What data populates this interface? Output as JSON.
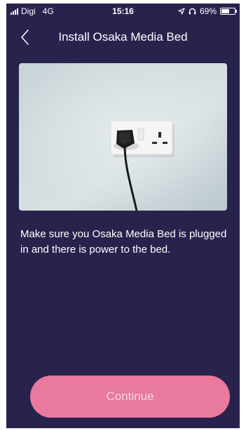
{
  "status_bar": {
    "carrier": "Digi",
    "network": "4G",
    "time": "15:16",
    "battery_percent": "69%",
    "battery_level": 0.69,
    "icons": [
      "signal-bars-icon",
      "location-arrow-icon",
      "headphones-icon",
      "battery-icon"
    ]
  },
  "nav": {
    "title": "Install Osaka Media Bed",
    "back_icon": "chevron-left-icon"
  },
  "content": {
    "instruction": "Make sure you Osaka Media Bed is plugged in and there is power to the bed."
  },
  "actions": {
    "continue_label": "Continue"
  },
  "colors": {
    "background": "#27234d",
    "accent_button": "#e9799d",
    "button_text": "#f6d4df"
  }
}
